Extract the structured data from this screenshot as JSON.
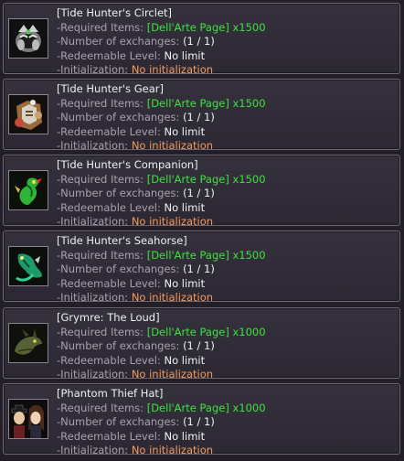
{
  "labels": {
    "required": "-Required Items: ",
    "exchanges": "-Number of exchanges: ",
    "level": "-Redeemable Level: ",
    "init": "-Initialization: "
  },
  "items": [
    {
      "title": "[Tide Hunter's Circlet]",
      "required_item": "[Dell'Arte Page] x1500",
      "exchanges": "(1 / 1)",
      "level": "No limit",
      "initialization": "No initialization",
      "icon": "silver-circlet-icon"
    },
    {
      "title": "[Tide Hunter's Gear]",
      "required_item": "[Dell'Arte Page] x1500",
      "exchanges": "(1 / 1)",
      "level": "No limit",
      "initialization": "No initialization",
      "icon": "armor-gear-icon"
    },
    {
      "title": "[Tide Hunter's Companion]",
      "required_item": "[Dell'Arte Page] x1500",
      "exchanges": "(1 / 1)",
      "level": "No limit",
      "initialization": "No initialization",
      "icon": "green-seahorse-companion-icon"
    },
    {
      "title": "[Tide Hunter's Seahorse]",
      "required_item": "[Dell'Arte Page] x1500",
      "exchanges": "(1 / 1)",
      "level": "No limit",
      "initialization": "No initialization",
      "icon": "seahorse-mount-icon"
    },
    {
      "title": "[Grymre: The Loud]",
      "required_item": "[Dell'Arte Page] x1000",
      "exchanges": "(1 / 1)",
      "level": "No limit",
      "initialization": "No initialization",
      "icon": "dragon-head-icon"
    },
    {
      "title": "[Phantom Thief Hat]",
      "required_item": "[Dell'Arte Page] x1000",
      "exchanges": "(1 / 1)",
      "level": "No limit",
      "initialization": "No initialization",
      "icon": "phantom-thief-characters-icon"
    }
  ]
}
